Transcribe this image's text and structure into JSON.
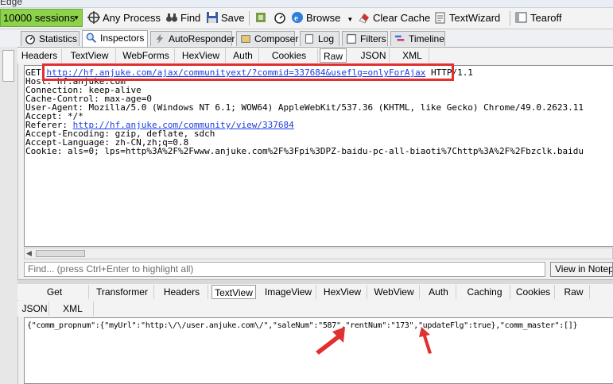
{
  "window_title": "Edge",
  "toolbar": {
    "sessions": "10000 sessions",
    "any_process": "Any Process",
    "find": "Find",
    "save": "Save",
    "browse": "Browse",
    "clear_cache": "Clear Cache",
    "textwizard": "TextWizard",
    "tearoff": "Tearoff"
  },
  "main_tabs": [
    "Statistics",
    "Inspectors",
    "AutoResponder",
    "Composer",
    "Log",
    "Filters",
    "Timeline"
  ],
  "request_tabs": [
    "Headers",
    "TextView",
    "WebForms",
    "HexView",
    "Auth",
    "Cookies",
    "Raw",
    "JSON",
    "XML"
  ],
  "request": {
    "method": "GET",
    "url": "http://hf.anjuke.com/ajax/communityext/?commid=337684&useflg=onlyForAjax",
    "protocol": "HTTP/1.1",
    "host": "Host: hf.anjuke.com",
    "connection": "Connection: keep-alive",
    "cache_control": "Cache-Control: max-age=0",
    "user_agent": "User-Agent: Mozilla/5.0 (Windows NT 6.1; WOW64) AppleWebKit/537.36 (KHTML, like Gecko) Chrome/49.0.2623.11",
    "accept": "Accept: */*",
    "referer_label": "Referer: ",
    "referer_url": "http://hf.anjuke.com/community/view/337684",
    "accept_encoding": "Accept-Encoding: gzip, deflate, sdch",
    "accept_language": "Accept-Language: zh-CN,zh;q=0.8",
    "cookie": "Cookie: als=0; lps=http%3A%2F%2Fwww.anjuke.com%2F%3Fpi%3DPZ-baidu-pc-all-biaoti%7Chttp%3A%2F%2Fbzclk.baidu"
  },
  "find": {
    "placeholder": "Find... (press Ctrl+Enter to highlight all)",
    "notepad_button": "View in Notepad"
  },
  "response_tabs_row1": [
    "Get SyntaxView",
    "Transformer",
    "Headers",
    "TextView",
    "ImageView",
    "HexView",
    "WebView",
    "Auth",
    "Caching",
    "Cookies",
    "Raw"
  ],
  "response_tabs_row2": [
    "JSON",
    "XML"
  ],
  "response_body": "{\"comm_propnum\":{\"myUrl\":\"http:\\/\\/user.anjuke.com\\/\",\"saleNum\":\"587\",\"rentNum\":\"173\",\"updateFlg\":true},\"comm_master\":[]}",
  "colors": {
    "sessions_bg": "#8cd24a",
    "highlight": "#e03030",
    "link": "#1c3de0"
  }
}
